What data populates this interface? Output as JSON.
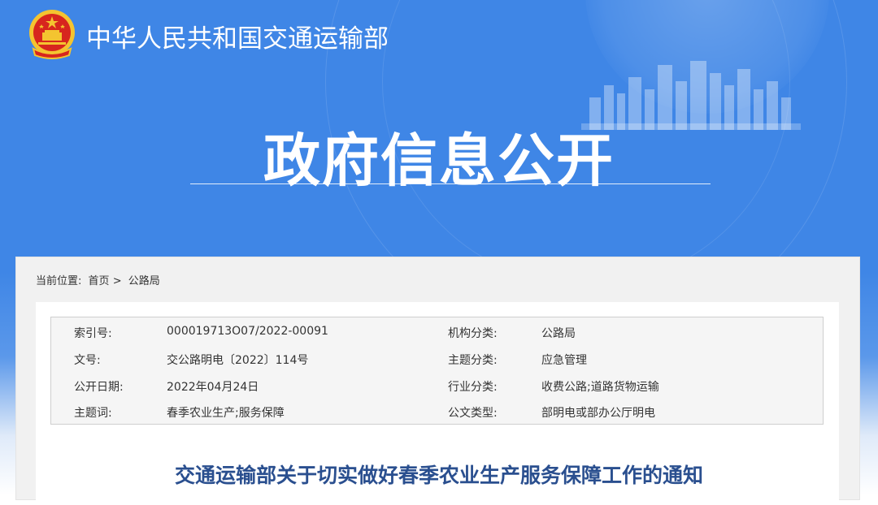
{
  "header": {
    "ministry_name": "中华人民共和国交通运输部",
    "banner_title": "政府信息公开"
  },
  "breadcrumb": {
    "label": "当前位置:",
    "items": [
      "首页",
      "公路局"
    ],
    "separator": ">"
  },
  "meta": [
    {
      "label": "索引号:",
      "value": "000019713O07/2022-00091",
      "label2": "机构分类:",
      "value2": "公路局"
    },
    {
      "label": "文号:",
      "value": "交公路明电〔2022〕114号",
      "label2": "主题分类:",
      "value2": "应急管理"
    },
    {
      "label": "公开日期:",
      "value": "2022年04月24日",
      "label2": "行业分类:",
      "value2": "收费公路;道路货物运输"
    },
    {
      "label": "主题词:",
      "value": "春季农业生产;服务保障",
      "label2": "公文类型:",
      "value2": "部明电或部办公厅明电"
    }
  ],
  "document": {
    "title": "交通运输部关于切实做好春季农业生产服务保障工作的通知"
  },
  "colors": {
    "banner_blue": "#3f86e6",
    "title_blue": "#2a4f8f",
    "emblem_red": "#d7261e",
    "emblem_gold": "#f4c430"
  }
}
